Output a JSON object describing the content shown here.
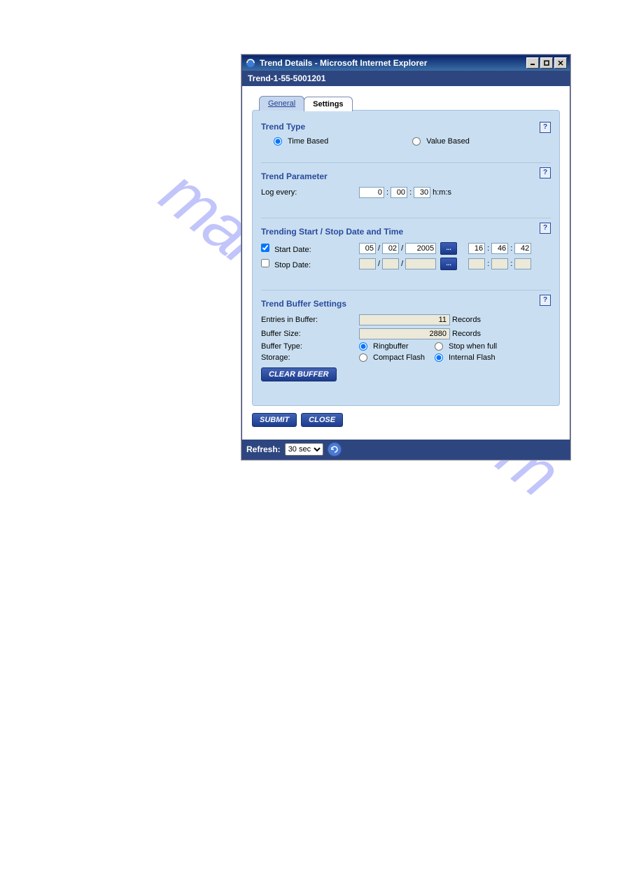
{
  "window": {
    "title": "Trend Details - Microsoft Internet Explorer"
  },
  "subheader": "Trend-1-55-5001201",
  "tabs": {
    "general": "General",
    "settings": "Settings"
  },
  "help_char": "?",
  "sections": {
    "trend_type": {
      "title": "Trend Type",
      "time_based": "Time Based",
      "value_based": "Value Based"
    },
    "trend_parameter": {
      "title": "Trend Parameter",
      "log_every_label": "Log every:",
      "h": "0",
      "m": "00",
      "s": "30",
      "units": "h:m:s"
    },
    "start_stop": {
      "title": "Trending Start / Stop Date and Time",
      "start_label": "Start Date:",
      "stop_label": "Stop Date:",
      "start_mm": "05",
      "start_dd": "02",
      "start_yyyy": "2005",
      "start_hh": "16",
      "start_min": "46",
      "start_ss": "42",
      "date_btn": "...",
      "sep_slash": "/",
      "sep_colon": ":"
    },
    "buffer": {
      "title": "Trend Buffer Settings",
      "entries_label": "Entries in Buffer:",
      "entries_value": "11",
      "size_label": "Buffer Size:",
      "size_value": "2880",
      "records": "Records",
      "buffer_type_label": "Buffer Type:",
      "ringbuffer": "Ringbuffer",
      "stop_when_full": "Stop when full",
      "storage_label": "Storage:",
      "compact_flash": "Compact Flash",
      "internal_flash": "Internal Flash",
      "clear_buffer": "CLEAR BUFFER"
    }
  },
  "buttons": {
    "submit": "SUBMIT",
    "close": "CLOSE"
  },
  "footer": {
    "refresh_label": "Refresh:",
    "refresh_value": "30 sec"
  },
  "watermark": "manualshive.com"
}
